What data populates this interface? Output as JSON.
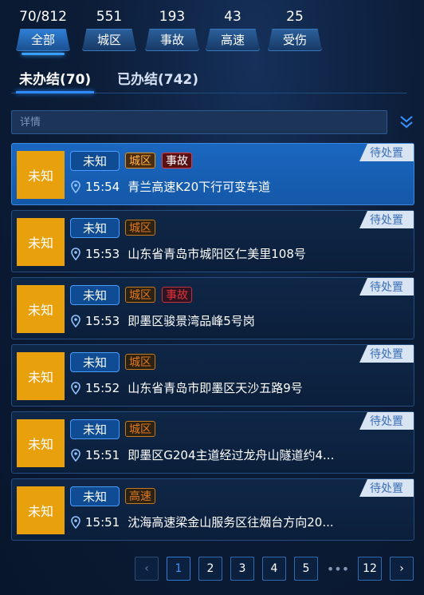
{
  "stats": [
    {
      "value": "70/812",
      "label": "全部"
    },
    {
      "value": "551",
      "label": "城区"
    },
    {
      "value": "193",
      "label": "事故"
    },
    {
      "value": "43",
      "label": "高速"
    },
    {
      "value": "25",
      "label": "受伤"
    }
  ],
  "tabs": [
    {
      "label": "未办结(70)"
    },
    {
      "label": "已办结(742)"
    }
  ],
  "search": {
    "placeholder": "详情"
  },
  "cards": [
    {
      "badge": "未知",
      "status": "未知",
      "tags": [
        "城区",
        "事故"
      ],
      "pending": "待处置",
      "time": "15:54",
      "address": "青兰高速K20下行可变车道"
    },
    {
      "badge": "未知",
      "status": "未知",
      "tags": [
        "城区"
      ],
      "pending": "待处置",
      "time": "15:53",
      "address": "山东省青岛市城阳区仁美里108号"
    },
    {
      "badge": "未知",
      "status": "未知",
      "tags": [
        "城区",
        "事故"
      ],
      "pending": "待处置",
      "time": "15:53",
      "address": "即墨区骏景湾品峰5号岗"
    },
    {
      "badge": "未知",
      "status": "未知",
      "tags": [
        "城区"
      ],
      "pending": "待处置",
      "time": "15:52",
      "address": "山东省青岛市即墨区天沙五路9号"
    },
    {
      "badge": "未知",
      "status": "未知",
      "tags": [
        "城区"
      ],
      "pending": "待处置",
      "time": "15:51",
      "address": "即墨区G204主道经过龙舟山隧道约4..."
    },
    {
      "badge": "未知",
      "status": "未知",
      "tags": [
        "高速"
      ],
      "pending": "待处置",
      "time": "15:51",
      "address": "沈海高速梁金山服务区往烟台方向20..."
    }
  ],
  "pagination": {
    "prev": "‹",
    "pages": [
      "1",
      "2",
      "3",
      "4",
      "5"
    ],
    "ellipsis": "•••",
    "last": "12",
    "next": "›",
    "current": "1"
  },
  "colors": {
    "background": "#0b1b33",
    "accent": "#2f8bff",
    "badge": "#e8a00c",
    "selected_card": "#1b67c0",
    "tag_city": "#e2781f",
    "tag_accident": "#e0323a"
  }
}
